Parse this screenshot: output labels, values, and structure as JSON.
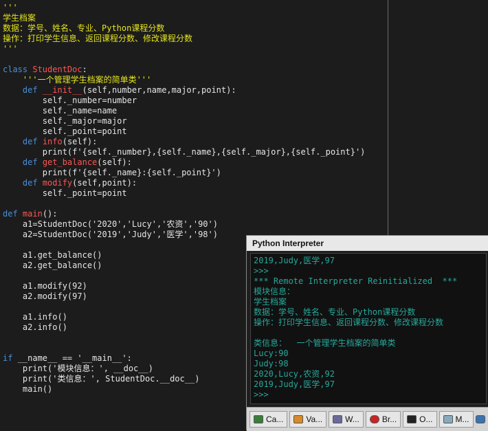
{
  "editor": {
    "lines": [
      [
        {
          "t": "'''",
          "c": "docstr"
        }
      ],
      [
        {
          "t": "学生档案",
          "c": "docstr"
        }
      ],
      [
        {
          "t": "数据：学号、姓名、专业、Python课程分数",
          "c": "docstr"
        }
      ],
      [
        {
          "t": "操作：打印学生信息、返回课程分数、修改课程分数",
          "c": "docstr"
        }
      ],
      [
        {
          "t": "'''",
          "c": "docstr"
        }
      ],
      [],
      [
        {
          "t": "class ",
          "c": "kw"
        },
        {
          "t": "StudentDoc",
          "c": "cls"
        },
        {
          "t": ":",
          "c": "plain"
        }
      ],
      [
        {
          "t": "    '''一个管理学生档案的简单类'''",
          "c": "docstr"
        }
      ],
      [
        {
          "t": "    ",
          "c": "plain"
        },
        {
          "t": "def ",
          "c": "kw"
        },
        {
          "t": "__init__",
          "c": "cls"
        },
        {
          "t": "(self,number,name,major,point):",
          "c": "plain"
        }
      ],
      [
        {
          "t": "        self._number=number",
          "c": "plain"
        }
      ],
      [
        {
          "t": "        self._name=name",
          "c": "plain"
        }
      ],
      [
        {
          "t": "        self._major=major",
          "c": "plain"
        }
      ],
      [
        {
          "t": "        self._point=point",
          "c": "plain"
        }
      ],
      [
        {
          "t": "    ",
          "c": "plain"
        },
        {
          "t": "def ",
          "c": "kw"
        },
        {
          "t": "info",
          "c": "cls"
        },
        {
          "t": "(self):",
          "c": "plain"
        }
      ],
      [
        {
          "t": "        print(f'{self._number},{self._name},{self._major},{self._point}')",
          "c": "plain"
        }
      ],
      [
        {
          "t": "    ",
          "c": "plain"
        },
        {
          "t": "def ",
          "c": "kw"
        },
        {
          "t": "get_balance",
          "c": "cls"
        },
        {
          "t": "(self):",
          "c": "plain"
        }
      ],
      [
        {
          "t": "        print(f'{self._name}:{self._point}')",
          "c": "plain"
        }
      ],
      [
        {
          "t": "    ",
          "c": "plain"
        },
        {
          "t": "def ",
          "c": "kw"
        },
        {
          "t": "modify",
          "c": "cls"
        },
        {
          "t": "(self,point):",
          "c": "plain"
        }
      ],
      [
        {
          "t": "        self._point=point",
          "c": "plain"
        }
      ],
      [],
      [
        {
          "t": "def ",
          "c": "kw"
        },
        {
          "t": "main",
          "c": "cls"
        },
        {
          "t": "():",
          "c": "plain"
        }
      ],
      [
        {
          "t": "    a1=StudentDoc('2020','Lucy','农资','90')",
          "c": "plain"
        }
      ],
      [
        {
          "t": "    a2=StudentDoc('2019','Judy','医学','98')",
          "c": "plain"
        }
      ],
      [],
      [
        {
          "t": "    a1.get_balance()",
          "c": "plain"
        }
      ],
      [
        {
          "t": "    a2.get_balance()",
          "c": "plain"
        }
      ],
      [],
      [
        {
          "t": "    a1.modify(92)",
          "c": "plain"
        }
      ],
      [
        {
          "t": "    a2.modify(97)",
          "c": "plain"
        }
      ],
      [],
      [
        {
          "t": "    a1.info()",
          "c": "plain"
        }
      ],
      [
        {
          "t": "    a2.info()",
          "c": "plain"
        }
      ],
      [],
      [],
      [
        {
          "t": "if ",
          "c": "kw"
        },
        {
          "t": "__name__ == '__main__':",
          "c": "plain"
        }
      ],
      [
        {
          "t": "    print('模块信息：', __doc__)",
          "c": "plain"
        }
      ],
      [
        {
          "t": "    print('类信息：', StudentDoc.__doc__)",
          "c": "plain"
        }
      ],
      [
        {
          "t": "    main()",
          "c": "plain"
        }
      ]
    ]
  },
  "interpreter": {
    "title": "Python Interpreter",
    "output": [
      "2019,Judy,医学,97",
      ">>>",
      "*** Remote Interpreter Reinitialized  ***",
      "模块信息：",
      "学生档案",
      "数据：学号、姓名、专业、Python课程分数",
      "操作：打印学生信息、返回课程分数、修改课程分数",
      "",
      "类信息：  一个管理学生档案的简单类",
      "Lucy:90",
      "Judy:98",
      "2020,Lucy,农资,92",
      "2019,Judy,医学,97",
      ">>>"
    ]
  },
  "taskbar": {
    "tabs": [
      {
        "label": "Ca...",
        "icon": "calc-icon"
      },
      {
        "label": "Va...",
        "icon": "variables-icon"
      },
      {
        "label": "W...",
        "icon": "watch-icon"
      },
      {
        "label": "Br...",
        "icon": "breakpoint-icon"
      },
      {
        "label": "O...",
        "icon": "output-icon"
      },
      {
        "label": "M...",
        "icon": "messages-icon"
      }
    ]
  },
  "colors": {
    "docstring": "#e3e320",
    "keyword": "#4a8fd8",
    "name": "#ff5555",
    "interpreter_text": "#27a89a"
  }
}
